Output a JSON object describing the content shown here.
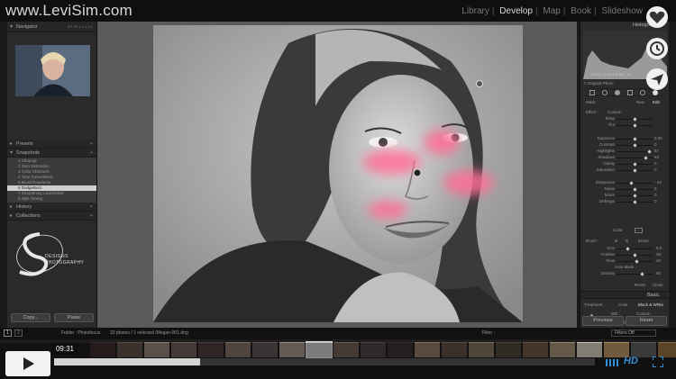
{
  "brand": "www.LeviSim.com",
  "modules": [
    {
      "label": "Library",
      "active": false
    },
    {
      "label": "Develop",
      "active": true
    },
    {
      "label": "Map",
      "active": false
    },
    {
      "label": "Book",
      "active": false
    },
    {
      "label": "Slideshow",
      "active": false
    }
  ],
  "left_panel": {
    "navigator_title": "Navigator",
    "navigator_zoom": "FIT  FILL  1:1  3:1",
    "presets_title": "Presets",
    "snapshots_title": "Snapshots",
    "snapshots": [
      "1 Cleanup",
      "2 Zero Saturation",
      "3 Color Channels",
      "4 Tone Curve/Basic",
      "5 Brush/Gradients",
      "6 DodgeBurn",
      "7 Sharpening Lips/Global",
      "8 Split Toning"
    ],
    "selected_snapshot_index": 5,
    "history_title": "History",
    "collections_title": "Collections",
    "logo_designs": "DESIGNS",
    "logo_photography": "PHOTOGRAPHY",
    "copy_button": "Copy...",
    "paste_button": "Paste"
  },
  "right_panel": {
    "histogram_title": "Histogram",
    "histogram_readout": "R  98.7   G  98.7   B  98.7 %",
    "original_photo": "Original Photo",
    "mask_label": "Mask :",
    "mask_new": "New",
    "mask_edit": "Edit",
    "effect_label": "Effect :",
    "effect_value": "Custom",
    "sliders": [
      {
        "label": "Temp",
        "value": ""
      },
      {
        "label": "Tint",
        "value": ""
      },
      {
        "label": "Exposure",
        "value": "0.00"
      },
      {
        "label": "Contrast",
        "value": "0"
      },
      {
        "label": "Highlights",
        "value": "87"
      },
      {
        "label": "Shadows",
        "value": "62"
      },
      {
        "label": "Clarity",
        "value": "0"
      },
      {
        "label": "Saturation",
        "value": "0"
      },
      {
        "label": "Sharpness",
        "value": "- 23"
      },
      {
        "label": "Noise",
        "value": "0"
      },
      {
        "label": "Moire",
        "value": "0"
      },
      {
        "label": "Defringe",
        "value": "0"
      }
    ],
    "color_label": "Color",
    "brush_label": "Brush :",
    "brush_a": "A",
    "brush_b": "B",
    "brush_erase": "Erase",
    "brush_sliders": [
      {
        "label": "Size",
        "value": "5.0"
      },
      {
        "label": "Feather",
        "value": "38"
      },
      {
        "label": "Flow",
        "value": "40"
      },
      {
        "label": "Density",
        "value": "60"
      }
    ],
    "auto_mask": "Auto Mask",
    "reset_button": "Reset",
    "close_button": "Close",
    "basic_title": "Basic",
    "treatment_label": "Treatment :",
    "treatment_color": "Color",
    "treatment_bw": "Black & White",
    "wb_label": "WB :",
    "wb_value": "Custom",
    "temp_label": "Temp",
    "temp_value": "4050",
    "tint_label": "Tint",
    "tint_value": "+ 18",
    "previous_button": "Previous",
    "reset_main_button": "Reset"
  },
  "filmstrip": {
    "page1": "1",
    "page2": "2",
    "folder_text": "Folder : Photofocus",
    "count_text": "33 photos / 1 selected /Megan-001.dng",
    "filter_label": "Filter :",
    "filter_value": "Filters Off"
  },
  "video": {
    "time": "09:31",
    "progress_fraction": 0.27,
    "hd_label": "HD"
  },
  "colors": {
    "accent_pink": "#ff6e96",
    "panel_bg": "#2b2b2b",
    "center_bg": "#5a5a5a",
    "video_blue": "#2f8fd8"
  }
}
